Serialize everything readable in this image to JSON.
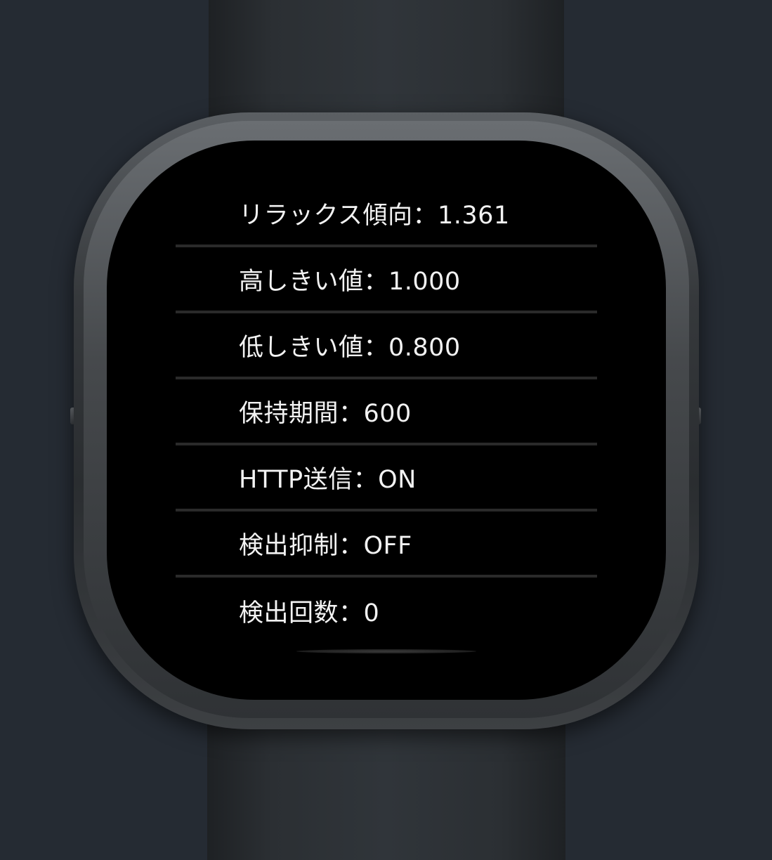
{
  "screen": {
    "rows": [
      {
        "text": "リラックス傾向：1.361"
      },
      {
        "text": "高しきい値：1.000"
      },
      {
        "text": "低しきい値：0.800"
      },
      {
        "text": "保持期間：600"
      },
      {
        "text": "HTTP送信：ON"
      },
      {
        "text": "検出抑制：OFF"
      },
      {
        "text": "検出回数：0"
      }
    ]
  },
  "colors": {
    "background": "#252b33",
    "screen": "#000000",
    "text": "#f2f2f2",
    "divider": "#2a2a2a"
  }
}
